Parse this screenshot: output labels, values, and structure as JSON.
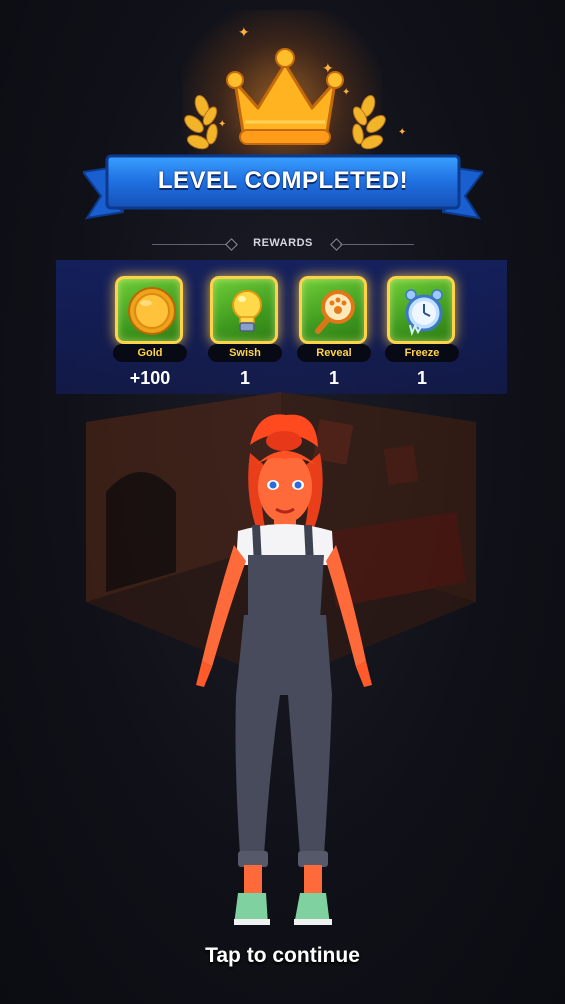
{
  "banner": {
    "title": "LEVEL COMPLETED!"
  },
  "rewards_section": {
    "label": "REWARDS"
  },
  "rewards": [
    {
      "name": "Gold",
      "amount": "+100",
      "icon": "gold-coin-icon"
    },
    {
      "name": "Swish",
      "amount": "1",
      "icon": "lightbulb-icon"
    },
    {
      "name": "Reveal",
      "amount": "1",
      "icon": "magnifier-icon"
    },
    {
      "name": "Freeze",
      "amount": "1",
      "icon": "frozen-clock-icon"
    }
  ],
  "footer": {
    "continue_label": "Tap to continue"
  },
  "colors": {
    "banner_blue": "#1f6fe0",
    "tile_green": "#4fae26",
    "tile_border_gold": "#ffd24a",
    "reward_name_yellow": "#ffd34a",
    "character_hair": "#ff4a1f"
  }
}
